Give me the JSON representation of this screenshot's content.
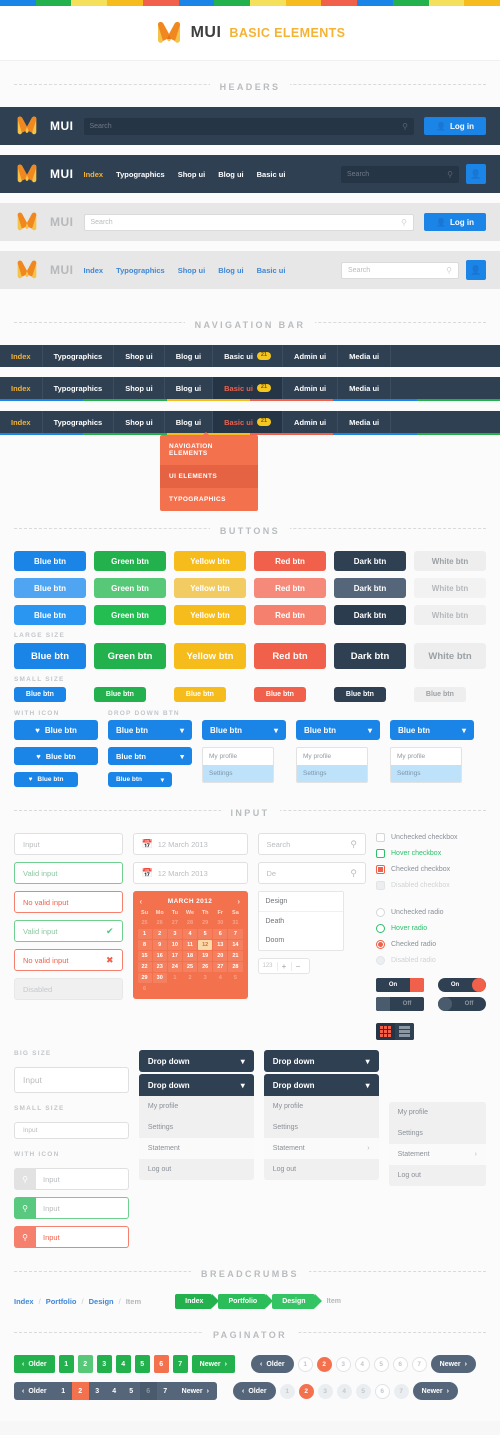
{
  "colorstrip": [
    "#1b84e7",
    "#22b14c",
    "#f5e05c",
    "#f5bc1c",
    "#f1604a",
    "#1b84e7",
    "#22b14c",
    "#f5e05c",
    "#f5bc1c",
    "#f1604a",
    "#1b84e7",
    "#22b14c",
    "#f5e05c",
    "#f5bc1c"
  ],
  "brand": {
    "logo_icon": "mui-logo-icon",
    "name": "MUI",
    "subtitle": "BASIC ELEMENTS"
  },
  "sections": {
    "headers": "HEADERS",
    "navigation_bar": "NAVIGATION BAR",
    "buttons": "BUTTONS",
    "input": "INPUT",
    "breadcrumbs": "BREADCRUMBS",
    "paginator": "PAGINATOR"
  },
  "headers": {
    "brand": "MUI",
    "search_placeholder": "Search",
    "login_label": "Log in",
    "user_icon": "user-icon",
    "search_icon": "search-icon",
    "nav": [
      {
        "label": "Index",
        "active": true
      },
      {
        "label": "Typographics",
        "active": false
      },
      {
        "label": "Shop ui",
        "active": false
      },
      {
        "label": "Blog ui",
        "active": false
      },
      {
        "label": "Basic ui",
        "active": false
      }
    ]
  },
  "navbar": {
    "items": [
      {
        "label": "Index",
        "state": "active"
      },
      {
        "label": "Typographics",
        "state": "normal"
      },
      {
        "label": "Shop ui",
        "state": "normal"
      },
      {
        "label": "Blog ui",
        "state": "normal"
      },
      {
        "label": "Basic ui",
        "state": "normal",
        "badge": "21"
      },
      {
        "label": "Admin ui",
        "state": "normal"
      },
      {
        "label": "Media ui",
        "state": "normal"
      }
    ],
    "items2": [
      {
        "label": "Index",
        "state": "active"
      },
      {
        "label": "Typographics",
        "state": "normal"
      },
      {
        "label": "Shop ui",
        "state": "normal"
      },
      {
        "label": "Blog ui",
        "state": "normal"
      },
      {
        "label": "Basic ui",
        "state": "red",
        "badge": "21"
      },
      {
        "label": "Admin ui",
        "state": "normal"
      },
      {
        "label": "Media ui",
        "state": "normal"
      }
    ],
    "underline_colors": [
      "#1b84e7",
      "#22b14c",
      "#f5bc1c",
      "#f1604a",
      "#1b84e7",
      "#22b14c"
    ],
    "dropdown": [
      {
        "label": "NAVIGATION ELEMENTS",
        "selected": false
      },
      {
        "label": "UI ELEMENTS",
        "selected": true
      },
      {
        "label": "TYPOGRAPHICS",
        "selected": false
      }
    ]
  },
  "buttons": {
    "labels": [
      "Blue btn",
      "Green btn",
      "Yellow btn",
      "Red btn",
      "Dark btn",
      "White btn"
    ],
    "small_label": "Blue btn",
    "sub_large": "LARGE SIZE",
    "sub_small": "SMALL SIZE",
    "sub_icon": "WITH ICON",
    "sub_dropdown": "DROP DOWN BTN",
    "icon_label": "Blue btn",
    "heart_icon": "heart-icon",
    "chevron_icon": "chevron-down-icon",
    "dropdown_items": [
      "My profile",
      "Settings"
    ]
  },
  "input": {
    "placeholder": "Input",
    "valid": "Valid input",
    "invalid": "No valid input",
    "disabled": "Disabled",
    "date": "12 March 2013",
    "search_placeholder": "Search",
    "search_typed": "De",
    "sub_big": "BIG SIZE",
    "sub_small": "SMALL SIZE",
    "sub_icon": "WITH ICON",
    "calendar_icon": "calendar-icon",
    "check_icon": "check-circle-icon",
    "error_icon": "error-circle-icon",
    "search_icon": "search-icon",
    "autocomplete": [
      "Design",
      "Death",
      "Doom"
    ],
    "stepper": {
      "value": "123",
      "plus": "+",
      "minus": "−"
    },
    "calendar": {
      "month": "MARCH 2012",
      "prev_icon": "chevron-left-icon",
      "next_icon": "chevron-right-icon",
      "daynames": [
        "Su",
        "Mo",
        "Tu",
        "We",
        "Th",
        "Fr",
        "Sa"
      ],
      "lead": [
        "25",
        "26",
        "27",
        "28",
        "29",
        "30",
        "31"
      ],
      "days": [
        "1",
        "2",
        "3",
        "4",
        "5",
        "6",
        "7",
        "8",
        "9",
        "10",
        "11",
        "12",
        "13",
        "14",
        "15",
        "16",
        "17",
        "18",
        "19",
        "20",
        "21",
        "22",
        "23",
        "24",
        "25",
        "26",
        "27",
        "28",
        "29",
        "30"
      ],
      "trail": [
        "1",
        "2",
        "3",
        "4",
        "5",
        "6"
      ],
      "selected": "12"
    },
    "checkboxes": [
      {
        "label": "Unchecked checkbox",
        "state": "normal"
      },
      {
        "label": "Hover checkbox",
        "state": "hover"
      },
      {
        "label": "Checked checkbox",
        "state": "checked"
      },
      {
        "label": "Disabled checkbox",
        "state": "disabled"
      }
    ],
    "radios": [
      {
        "label": "Unchecked radio",
        "state": "normal"
      },
      {
        "label": "Hover radio",
        "state": "hover"
      },
      {
        "label": "Checked radio",
        "state": "checked"
      },
      {
        "label": "Disabled radio",
        "state": "disabled"
      }
    ],
    "toggles": {
      "on": "On",
      "off": "Off"
    },
    "view_toggle": {
      "grid_icon": "grid-view-icon",
      "list_icon": "list-view-icon"
    },
    "dropdown_label": "Drop down",
    "menu": [
      {
        "label": "My profile",
        "submenu": false,
        "selected": false
      },
      {
        "label": "Settings",
        "submenu": false,
        "selected": false
      },
      {
        "label": "Statement",
        "submenu": true,
        "selected": true
      },
      {
        "label": "Log out",
        "submenu": false,
        "selected": false
      }
    ]
  },
  "breadcrumbs": {
    "plain": [
      "Index",
      "Portfolio",
      "Design",
      "Item"
    ],
    "separator": "/",
    "arrow": [
      "Index",
      "Portfolio",
      "Design"
    ],
    "arrow_last": "Item"
  },
  "paginator": {
    "older": "Older",
    "newer": "Newer",
    "prev_icon": "chevron-left-icon",
    "next_icon": "chevron-right-icon",
    "pages": [
      "1",
      "2",
      "3",
      "4",
      "5",
      "6",
      "7"
    ],
    "green_active": "6",
    "green_alt": "2",
    "dark_active": "2",
    "dark_dim": "6",
    "round_active": "2",
    "round_outline": "6"
  }
}
